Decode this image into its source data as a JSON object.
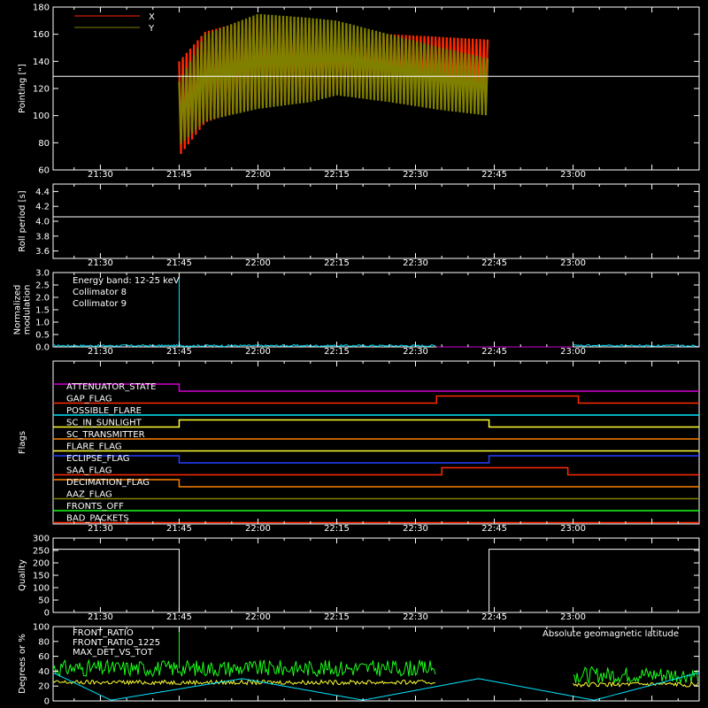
{
  "colors": {
    "background": "#000000",
    "axis": "#ffffff",
    "x_series": "#ff2a00",
    "y_series": "#808000",
    "cyan": "#00e5ff",
    "magenta": "#d000d0",
    "green": "#1aff1a",
    "yellow": "#ffff33",
    "orange": "#ff8000"
  },
  "time_ticks": [
    "21:30",
    "21:45",
    "22:00",
    "22:15",
    "22:30",
    "22:45",
    "23:00"
  ],
  "chart_data": [
    {
      "id": "pointing",
      "type": "area",
      "ylabel": "Pointing [\"]",
      "ylim": [
        60,
        180
      ],
      "yticks": [
        "60",
        "80",
        "100",
        "120",
        "140",
        "160",
        "180"
      ],
      "reference_line": 129,
      "legend": [
        {
          "name": "X",
          "color": "#ff2a00"
        },
        {
          "name": "Y",
          "color": "#808000"
        }
      ],
      "series": [
        {
          "name": "X",
          "x": [
            "21:45",
            "21:50",
            "22:00",
            "22:10",
            "22:15",
            "22:25",
            "22:35",
            "22:44"
          ],
          "upper": [
            140,
            162,
            172,
            168,
            162,
            160,
            158,
            156
          ],
          "lower": [
            70,
            95,
            108,
            112,
            118,
            116,
            114,
            112
          ]
        },
        {
          "name": "Y",
          "x": [
            "21:45",
            "21:50",
            "22:00",
            "22:10",
            "22:15",
            "22:25",
            "22:35",
            "22:44"
          ],
          "upper": [
            125,
            160,
            175,
            172,
            170,
            160,
            150,
            142
          ],
          "lower": [
            78,
            96,
            105,
            110,
            115,
            110,
            104,
            100
          ]
        }
      ]
    },
    {
      "id": "roll",
      "type": "line",
      "ylabel": "Roll period [s]",
      "ylim": [
        3.5,
        4.5
      ],
      "yticks": [
        "3.6",
        "3.8",
        "4.0",
        "4.2",
        "4.4"
      ],
      "series": [
        {
          "x": [
            "21:21",
            "23:24"
          ],
          "y": [
            4.06,
            4.06
          ]
        }
      ]
    },
    {
      "id": "modulation",
      "type": "line",
      "ylabel": "Normalized modulation",
      "ylim": [
        0,
        3
      ],
      "yticks": [
        "0.0",
        "0.5",
        "1.0",
        "1.5",
        "2.0",
        "2.5",
        "3.0"
      ],
      "annotation": "Energy band: 12-25 keV",
      "legend": [
        {
          "name": "Collimator 8",
          "color": "#00e5ff"
        },
        {
          "name": "Collimator 9",
          "color": "#d000d0"
        }
      ],
      "series": [
        {
          "name": "Collimator 8",
          "segments": [
            {
              "x": [
                "21:21",
                "22:34"
              ],
              "level": 0.05
            },
            {
              "x": [
                "23:00",
                "23:24"
              ],
              "level": 0.05
            }
          ],
          "spike": {
            "x": "21:45",
            "y": 2.8
          }
        },
        {
          "name": "Collimator 9",
          "segments": [
            {
              "x": [
                "22:34",
                "23:00"
              ],
              "level": 0.0
            }
          ]
        }
      ]
    },
    {
      "id": "flags",
      "type": "line",
      "ylabel": "Flags",
      "flags": [
        {
          "label": "ATTENUATOR_STATE",
          "color": "#d000d0",
          "steps": [
            [
              "21:21",
              1
            ],
            [
              "21:45",
              0
            ],
            [
              "23:24",
              0
            ]
          ]
        },
        {
          "label": "GAP_FLAG",
          "color": "#ff2a00",
          "steps": [
            [
              "21:21",
              0
            ],
            [
              "22:34",
              1
            ],
            [
              "23:01",
              0
            ],
            [
              "23:24",
              0
            ]
          ]
        },
        {
          "label": "POSSIBLE_FLARE",
          "color": "#00e5ff",
          "steps": [
            [
              "21:21",
              0
            ],
            [
              "23:24",
              0
            ]
          ]
        },
        {
          "label": "SC_IN_SUNLIGHT",
          "color": "#ffff33",
          "steps": [
            [
              "21:21",
              0
            ],
            [
              "21:45",
              1
            ],
            [
              "22:44",
              0
            ],
            [
              "23:24",
              0
            ]
          ]
        },
        {
          "label": "SC_TRANSMITTER",
          "color": "#ff8000",
          "steps": [
            [
              "21:21",
              0
            ],
            [
              "23:24",
              0
            ]
          ]
        },
        {
          "label": "FLARE_FLAG",
          "color": "#ffff33",
          "steps": [
            [
              "21:21",
              0
            ],
            [
              "23:24",
              0
            ]
          ]
        },
        {
          "label": "ECLIPSE_FLAG",
          "color": "#2040ff",
          "steps": [
            [
              "21:21",
              1
            ],
            [
              "21:45",
              0
            ],
            [
              "22:44",
              1
            ],
            [
              "23:24",
              1
            ]
          ]
        },
        {
          "label": "SAA_FLAG",
          "color": "#ff2a00",
          "steps": [
            [
              "21:21",
              0
            ],
            [
              "22:35",
              1
            ],
            [
              "22:59",
              0
            ],
            [
              "23:24",
              0
            ]
          ]
        },
        {
          "label": "DECIMATION_FLAG",
          "color": "#ff8000",
          "steps": [
            [
              "21:21",
              1
            ],
            [
              "21:45",
              0
            ],
            [
              "22:44",
              0
            ],
            [
              "23:24",
              0
            ]
          ]
        },
        {
          "label": "AAZ_FLAG",
          "color": "#808000",
          "steps": [
            [
              "21:21",
              0
            ],
            [
              "23:24",
              0
            ]
          ]
        },
        {
          "label": "FRONTS_OFF",
          "color": "#1aff1a",
          "steps": [
            [
              "21:21",
              0
            ],
            [
              "23:24",
              0
            ]
          ]
        },
        {
          "label": "BAD_PACKETS",
          "color": "#ff2a00",
          "steps": [
            [
              "21:21",
              0
            ],
            [
              "23:24",
              0
            ]
          ]
        }
      ]
    },
    {
      "id": "quality",
      "type": "line",
      "ylabel": "Quality",
      "ylim": [
        0,
        300
      ],
      "yticks": [
        "0",
        "50",
        "100",
        "150",
        "200",
        "250",
        "300"
      ],
      "series": [
        {
          "steps": [
            [
              "21:21",
              255
            ],
            [
              "21:45",
              0
            ],
            [
              "22:44",
              255
            ],
            [
              "23:24",
              255
            ]
          ]
        }
      ]
    },
    {
      "id": "geo",
      "type": "line",
      "ylabel": "Degrees or %",
      "ylim": [
        0,
        100
      ],
      "yticks": [
        "0",
        "20",
        "40",
        "60",
        "80",
        "100"
      ],
      "legend": [
        {
          "name": "FRONT_RATIO",
          "color": "#ffff33"
        },
        {
          "name": "FRONT_RATIO_1225",
          "color": "#1aff1a"
        },
        {
          "name": "MAX_DET_VS_TOT",
          "color": "#ff8000"
        }
      ],
      "right_label": {
        "text": "Absolute geomagnetic latitude",
        "color": "#00e5ff"
      },
      "series": [
        {
          "name": "FRONT_RATIO_1225",
          "segments": [
            {
              "x": [
                "21:21",
                "22:34"
              ],
              "level": 44
            },
            {
              "x": [
                "23:00",
                "23:24"
              ],
              "level": 35
            }
          ],
          "spike": {
            "x": "21:45",
            "y": 100
          }
        },
        {
          "name": "FRONT_RATIO",
          "segments": [
            {
              "x": [
                "21:21",
                "22:34"
              ],
              "level": 25
            },
            {
              "x": [
                "23:00",
                "23:24"
              ],
              "level": 22
            }
          ]
        },
        {
          "name": "Absolute geomagnetic latitude",
          "x": [
            "21:21",
            "21:32",
            "21:57",
            "22:20",
            "22:42",
            "23:04",
            "23:24"
          ],
          "y": [
            38,
            1,
            30,
            1,
            30,
            1,
            38
          ]
        }
      ]
    }
  ]
}
